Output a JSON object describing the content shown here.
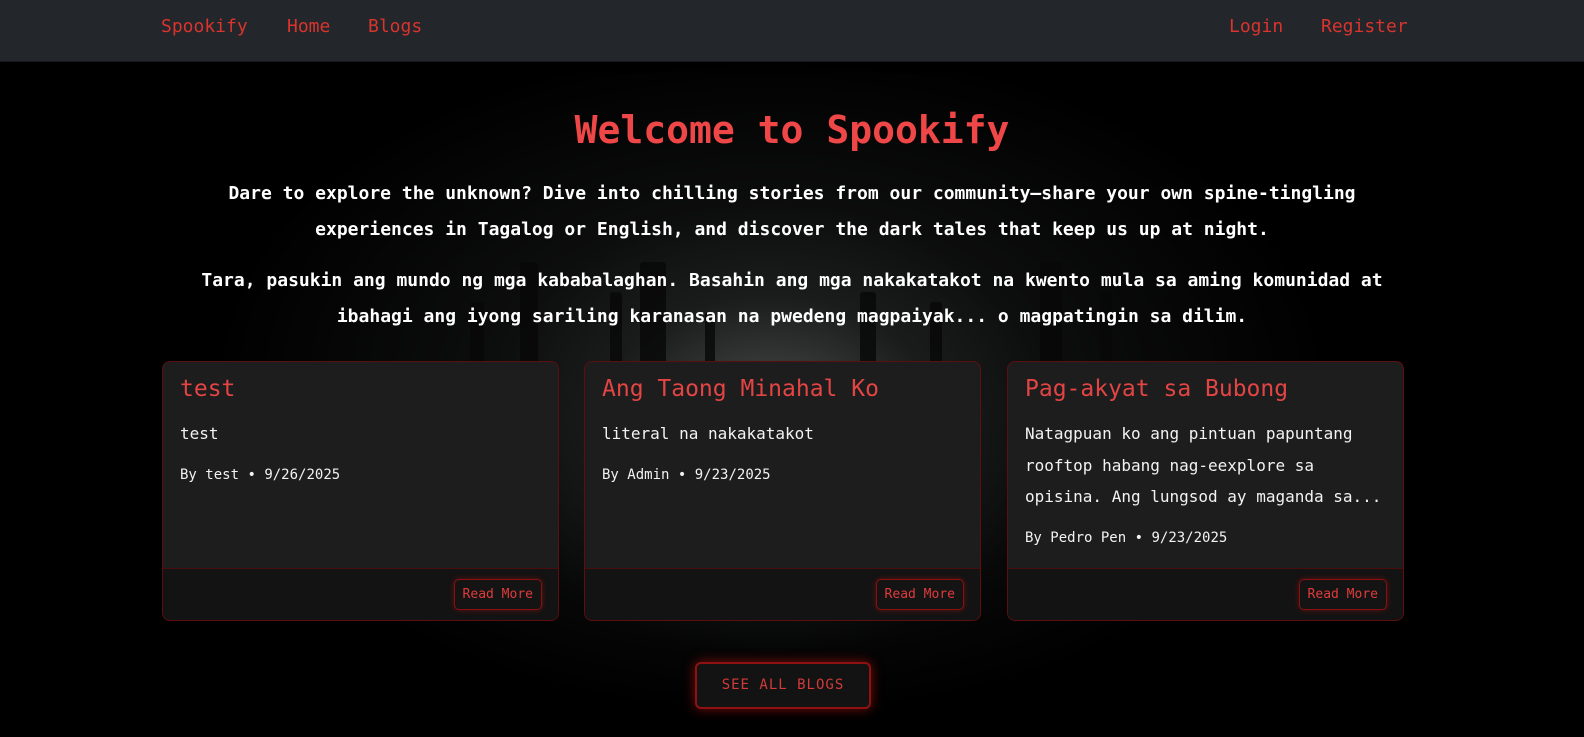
{
  "nav": {
    "brand": "Spookify",
    "home": "Home",
    "blogs": "Blogs",
    "login": "Login",
    "register": "Register"
  },
  "hero": {
    "title": "Welcome to Spookify",
    "en_line1": "Dare to explore the unknown? Dive into chilling stories from our community—share your own spine-tingling",
    "en_line2": "experiences in Tagalog or English, and discover the dark tales that keep us up at night.",
    "tl_line1": "Tara, pasukin ang mundo ng mga kababalaghan. Basahin ang mga nakakatakot na kwento mula sa aming komunidad at",
    "tl_line2": "ibahagi ang iyong sariling karanasan na pwedeng magpaiyak... o magpatingin sa dilim."
  },
  "cards": [
    {
      "title": "test",
      "excerpt": "test",
      "author": "By test",
      "separator": "•",
      "date": "9/26/2025",
      "read_more": "Read More"
    },
    {
      "title": "Ang Taong Minahal Ko",
      "excerpt": "literal na nakakatakot",
      "author": "By Admin",
      "separator": "•",
      "date": "9/23/2025",
      "read_more": "Read More"
    },
    {
      "title": "Pag-akyat sa Bubong",
      "excerpt_line1": "Natagpuan ko ang pintuan papuntang",
      "excerpt_line2": "rooftop habang nag-eexplore sa",
      "excerpt_line3": "opisina. Ang lungsod ay maganda sa...",
      "author": "By Pedro Pen",
      "separator": "•",
      "date": "9/23/2025",
      "read_more": "Read More"
    }
  ],
  "see_all": "SEE ALL BLOGS",
  "colors": {
    "accent": "#d9342e",
    "title": "#ef4747",
    "nav_bg": "#23262a",
    "card_bg": "#1d1d1d",
    "card_border": "#5b0f0f"
  }
}
